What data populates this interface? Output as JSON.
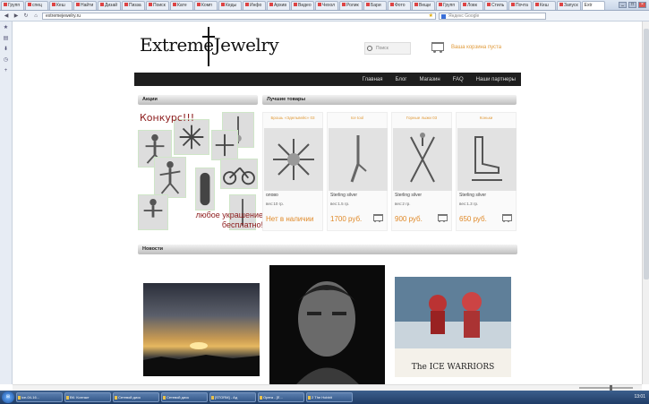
{
  "browser": {
    "tabs": [
      "Групп",
      "спец",
      "Кеш",
      "Найти",
      "Дизай",
      "Пизза",
      "Поиск",
      "Кате",
      "Комп",
      "Кеды",
      "Инфо",
      "Архив",
      "Видео",
      "Чехол",
      "Ролик",
      "Бари",
      "Фото",
      "Вещи",
      "Групп",
      "Ловк",
      "Стиль",
      "Почта",
      "Кеш",
      "Запуск"
    ],
    "active_tab_label": "Extr",
    "url": "extremejewelry.ru",
    "search_placeholder": "Яндекс Google",
    "nav_icons": [
      "back-icon",
      "forward-icon",
      "reload-icon",
      "home-icon"
    ]
  },
  "site": {
    "logo": "ExtremeJewelry",
    "search_placeholder": "Поиск",
    "cart_label": "Ваша корзина пуста",
    "nav": [
      "Главная",
      "Блог",
      "Магазин",
      "FAQ",
      "Наши партнеры"
    ],
    "sections": {
      "promo": "Акции",
      "best": "Лучшие товары",
      "news": "Новости"
    },
    "promo": {
      "title": "Конкурс!!!",
      "text": "любое украшение бесплатно!"
    },
    "products": [
      {
        "name": "Брошь «Эдельвейс» 03",
        "desc": "олово",
        "weight": "вес:10 гр.",
        "price": "Нет в наличии"
      },
      {
        "name": "Ice tool",
        "desc": "Sterling silver",
        "weight": "вес:1.5 гр.",
        "price": "1700 руб."
      },
      {
        "name": "Горные лыжи 03",
        "desc": "Sterling silver",
        "weight": "вес:2 гр.",
        "price": "900 руб."
      },
      {
        "name": "Коньки",
        "desc": "Sterling silver",
        "weight": "вес:1.3 гр.",
        "price": "650 руб."
      }
    ],
    "news_caption": "The ICE WARRIORS"
  },
  "taskbar": {
    "items": [
      "ice-04-16...",
      "ВК: Контакт",
      "Сетевой диск",
      "Сетевой диск",
      "[STORM] - Ад",
      "Opera - [E...",
      "2 The Hobbit"
    ],
    "clock": "13:01"
  }
}
